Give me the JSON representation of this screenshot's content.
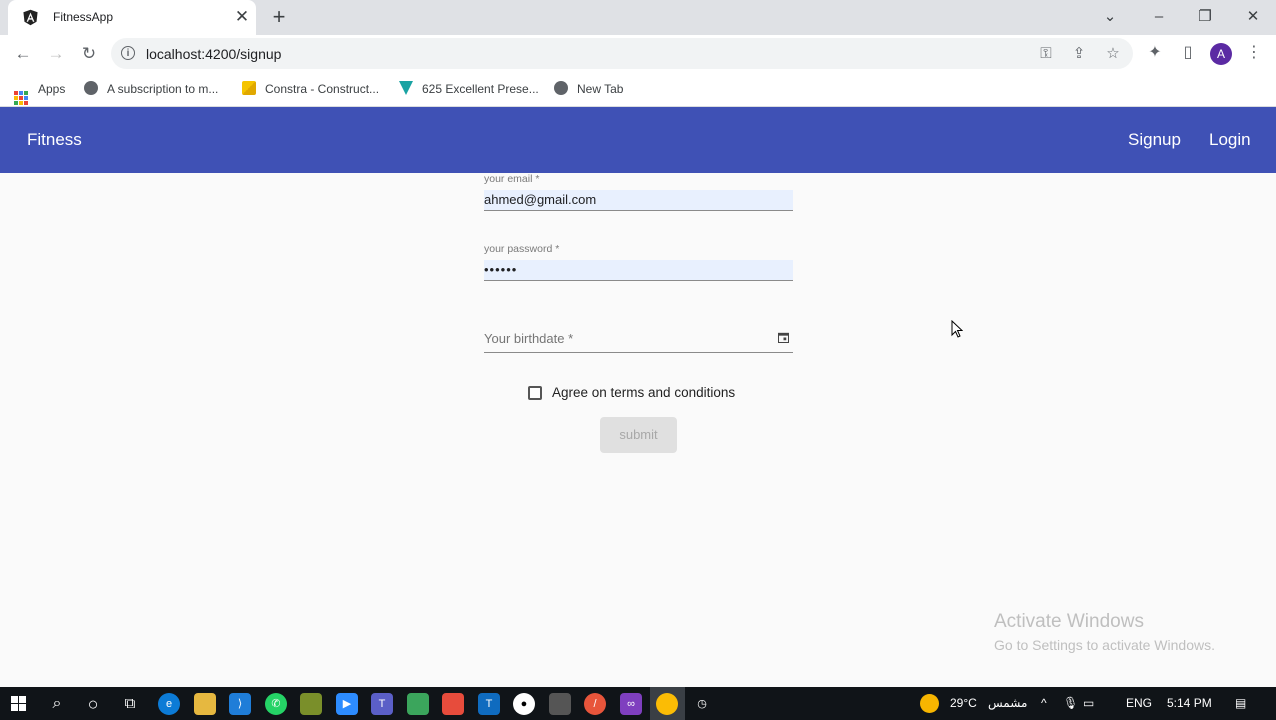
{
  "browser": {
    "tab_title": "FitnessApp",
    "url": "localhost:4200/signup",
    "bookmarks": [
      {
        "label": "Apps",
        "icon": "apps-grid-icon"
      },
      {
        "label": "A subscription to m...",
        "icon": "globe-icon"
      },
      {
        "label": "Constra - Construct...",
        "icon": "constra-icon"
      },
      {
        "label": "625 Excellent Prese...",
        "icon": "bookmark-site-icon"
      },
      {
        "label": "New Tab",
        "icon": "globe-icon"
      }
    ],
    "profile_initial": "A"
  },
  "app": {
    "brand": "Fitness",
    "nav": {
      "signup": "Signup",
      "login": "Login"
    },
    "colors": {
      "primary": "#3f51b5",
      "autofill": "#e8f0fe"
    }
  },
  "form": {
    "email_label": "your email *",
    "email_value": "ahmed@gmail.com",
    "password_label": "your password *",
    "password_value": "••••••",
    "birthdate_placeholder": "Your birthdate *",
    "terms_label": "Agree on terms and conditions",
    "terms_checked": false,
    "submit_label": "submit"
  },
  "watermark": {
    "line1": "Activate Windows",
    "line2": "Go to Settings to activate Windows."
  },
  "taskbar": {
    "weather_temp": "29°C",
    "weather_text": "مشمس",
    "language": "ENG",
    "time": "5:14 PM"
  }
}
